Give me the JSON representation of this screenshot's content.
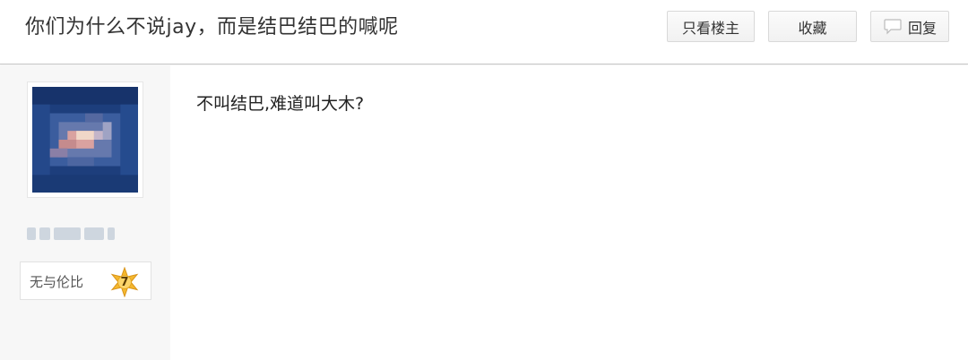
{
  "thread": {
    "title": "你们为什么不说jay，而是结巴结巴的喊呢"
  },
  "toolbar": {
    "only_op_label": "只看楼主",
    "favorite_label": "收藏",
    "reply_label": "回复",
    "reply_icon": "speech-bubble-icon"
  },
  "author": {
    "avatar_icon": "pixelated-avatar",
    "level_title": "无与伦比",
    "level_number": "7",
    "level_badge_icon": "star-badge-icon",
    "level_badge_color": "#f5b82e"
  },
  "post": {
    "content": "不叫结巴,难道叫大木?"
  }
}
